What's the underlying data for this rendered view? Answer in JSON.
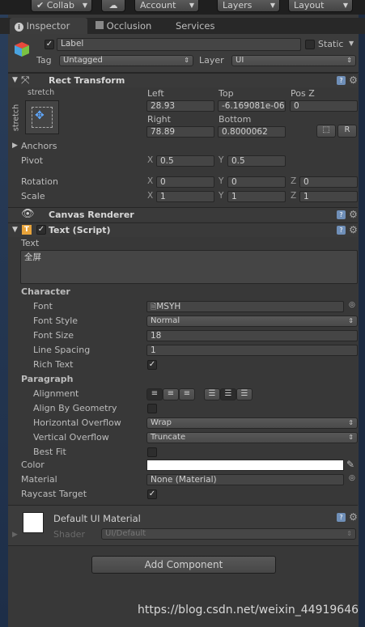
{
  "toolbar": {
    "collab": "Collab",
    "account": "Account",
    "layers": "Layers",
    "layout": "Layout",
    "cloud_icon": "cloud-icon"
  },
  "tabs": [
    {
      "label": "Inspector"
    },
    {
      "label": "Occlusion"
    },
    {
      "label": "Services"
    }
  ],
  "object": {
    "name": "Label",
    "static_label": "Static",
    "tag_label": "Tag",
    "tag_value": "Untagged",
    "layer_label": "Layer",
    "layer_value": "UI"
  },
  "rect_transform": {
    "title": "Rect Transform",
    "anchor_preset": "stretch",
    "anchor_preset_vertical": "stretch",
    "left_label": "Left",
    "top_label": "Top",
    "posz_label": "Pos Z",
    "left": "28.93",
    "top": "-6.169081e-06",
    "posz": "0",
    "right_label": "Right",
    "bottom_label": "Bottom",
    "right": "78.89",
    "bottom": "0.8000062",
    "r_button": "R",
    "anchors_label": "Anchors",
    "pivot_label": "Pivot",
    "pivot_x": "0.5",
    "pivot_y": "0.5",
    "rotation_label": "Rotation",
    "rot_x": "0",
    "rot_y": "0",
    "rot_z": "0",
    "scale_label": "Scale",
    "scale_x": "1",
    "scale_y": "1",
    "scale_z": "1",
    "x": "X",
    "y": "Y",
    "z": "Z"
  },
  "canvas_renderer": {
    "title": "Canvas Renderer"
  },
  "text_script": {
    "title": "Text (Script)",
    "text_label": "Text",
    "text_value": "全屏",
    "character_label": "Character",
    "font_label": "Font",
    "font_value": "MSYH",
    "font_style_label": "Font Style",
    "font_style_value": "Normal",
    "font_size_label": "Font Size",
    "font_size_value": "18",
    "line_spacing_label": "Line Spacing",
    "line_spacing_value": "1",
    "rich_text_label": "Rich Text",
    "paragraph_label": "Paragraph",
    "alignment_label": "Alignment",
    "align_by_geometry_label": "Align By Geometry",
    "horizontal_overflow_label": "Horizontal Overflow",
    "horizontal_overflow_value": "Wrap",
    "vertical_overflow_label": "Vertical Overflow",
    "vertical_overflow_value": "Truncate",
    "best_fit_label": "Best Fit",
    "color_label": "Color",
    "color_value": "#ffffff",
    "material_label": "Material",
    "material_value": "None (Material)",
    "raycast_label": "Raycast Target"
  },
  "material": {
    "name": "Default UI Material",
    "shader_label": "Shader",
    "shader_value": "UI/Default"
  },
  "add_component": "Add Component",
  "watermark": "https://blog.csdn.net/weixin_44919646"
}
